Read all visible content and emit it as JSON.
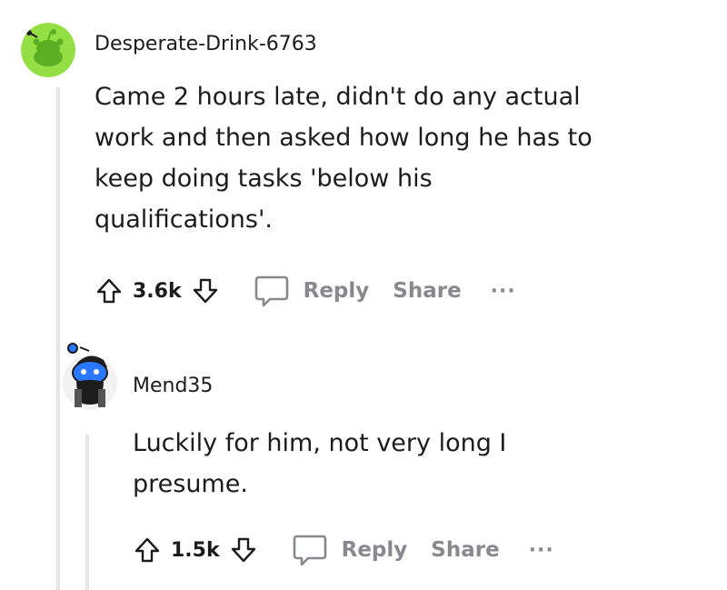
{
  "colors": {
    "text": "#1c1c1c",
    "muted": "#878a8c",
    "thread_line": "#e6e6e6",
    "avatar_green": "#94e044",
    "avatar_blue": "#2a78ff"
  },
  "comments": [
    {
      "username": "Desperate-Drink-6763",
      "avatar_icon": "snoo-avatar-icon",
      "lines": [
        "Came 2 hours late, didn't do any actual",
        "work and then asked how long he has to",
        "keep doing tasks 'below his",
        "qualifications'."
      ],
      "votes": "3.6k",
      "reply_label": "Reply",
      "share_label": "Share",
      "more_label": "···"
    },
    {
      "username": "Mend35",
      "avatar_icon": "snoo-avatar-icon",
      "lines": [
        "Luckily for him, not very long I",
        "presume."
      ],
      "votes": "1.5k",
      "reply_label": "Reply",
      "share_label": "Share",
      "more_label": "···"
    }
  ]
}
